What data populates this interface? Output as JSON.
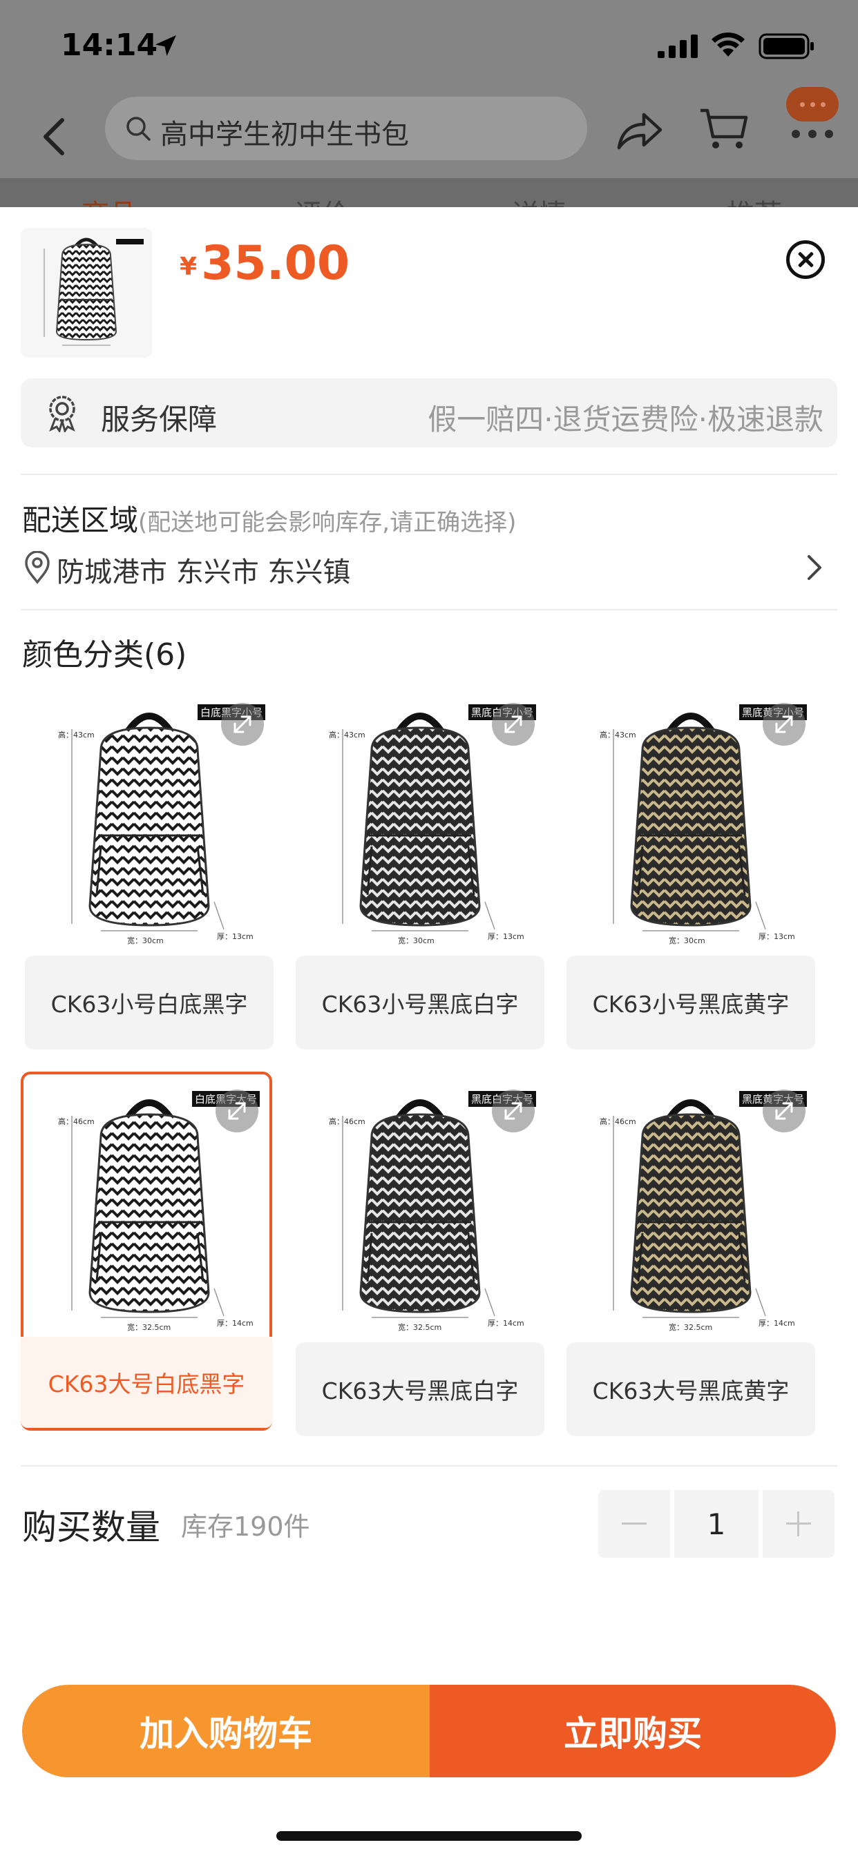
{
  "status_bar": {
    "time": "14:14"
  },
  "nav": {
    "search_text": "高中学生初中生书包",
    "behind_tabs": [
      "商品",
      "评价",
      "详情",
      "推荐"
    ]
  },
  "product": {
    "currency": "¥",
    "price": "35.00"
  },
  "service": {
    "label": "服务保障",
    "desc": "假一赔四·退货运费险·极速退款"
  },
  "delivery": {
    "title": "配送区域",
    "note": "(配送地可能会影响库存,请正确选择)",
    "address": "防城港市 东兴市 东兴镇"
  },
  "colors": {
    "title": "颜色分类(6)",
    "items": [
      {
        "label": "CK63小号白底黑字",
        "tag": "白底黑字小号",
        "pattern": "light",
        "height": "高：43cm",
        "width": "宽：30cm",
        "depth": "厚：13cm",
        "selected": false
      },
      {
        "label": "CK63小号黑底白字",
        "tag": "黑底白字小号",
        "pattern": "dark",
        "height": "高：43cm",
        "width": "宽：30cm",
        "depth": "厚：13cm",
        "selected": false
      },
      {
        "label": "CK63小号黑底黄字",
        "tag": "黑底黄字小号",
        "pattern": "darkyellow",
        "height": "高：43cm",
        "width": "宽：30cm",
        "depth": "厚：13cm",
        "selected": false
      },
      {
        "label": "CK63大号白底黑字",
        "tag": "白底黑字大号",
        "pattern": "light",
        "height": "高：46cm",
        "width": "宽：32.5cm",
        "depth": "厚：14cm",
        "selected": true
      },
      {
        "label": "CK63大号黑底白字",
        "tag": "黑底白字大号",
        "pattern": "dark",
        "height": "高：46cm",
        "width": "宽：32.5cm",
        "depth": "厚：14cm",
        "selected": false
      },
      {
        "label": "CK63大号黑底黄字",
        "tag": "黑底黄字大号",
        "pattern": "darkyellow",
        "height": "高：46cm",
        "width": "宽：32.5cm",
        "depth": "厚：14cm",
        "selected": false
      }
    ]
  },
  "quantity": {
    "label": "购买数量",
    "stock": "库存190件",
    "value": "1"
  },
  "actions": {
    "add_to_cart": "加入购物车",
    "buy_now": "立即购买"
  },
  "theme": {
    "accent": "#ee5a24",
    "cart_button": "#f7952f",
    "overlay": "#858585"
  }
}
